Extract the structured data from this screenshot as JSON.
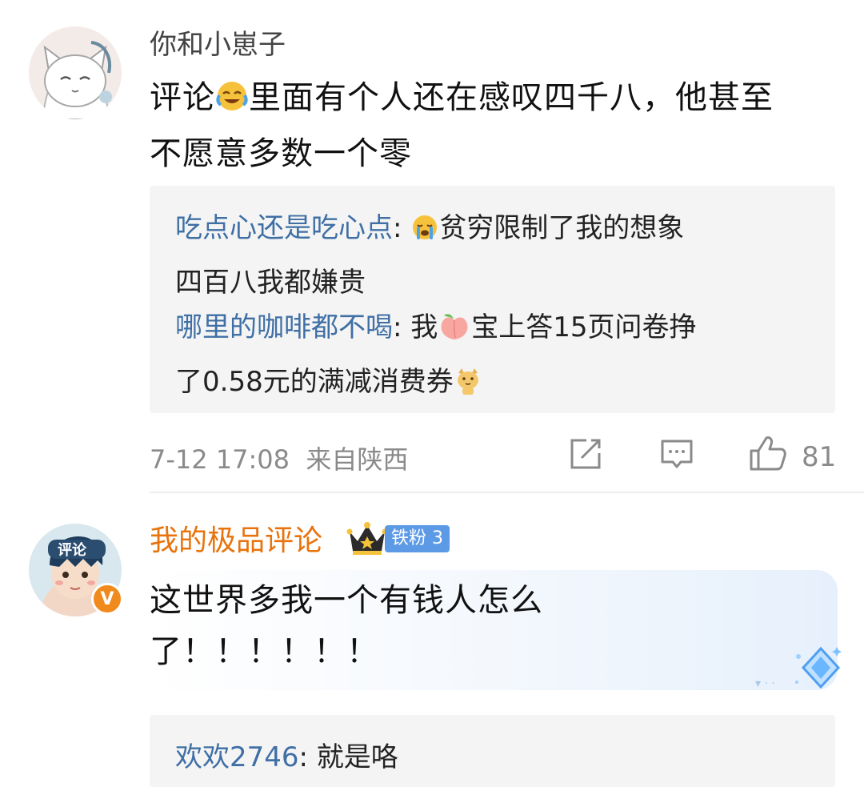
{
  "comment1": {
    "username": "你和小崽子",
    "text_a": "评论",
    "text_b": "里面有个人还在感叹四千八，他甚至",
    "text_c": "不愿意多数一个零",
    "replies": [
      {
        "name": "吃点心还是吃心点",
        "sep": ": ",
        "line1": "贫穷限制了我的想象",
        "line2": "四百八我都嫌贵"
      },
      {
        "name": "哪里的咖啡都不喝",
        "sep": ": ",
        "pre": "我",
        "post": "宝上答15页问卷挣",
        "line2": "了0.58元的满减消费券"
      }
    ],
    "time": "7-12 17:08",
    "location": "来自陕西",
    "like_count": "81"
  },
  "comment2": {
    "username": "我的极品评论",
    "badge": "铁粉",
    "badge_level": "3",
    "verified_mark": "V",
    "avatar_text": "评论",
    "text_a": "这世界多我一个有钱人怎么",
    "text_b": "了！！！！！！",
    "reply": {
      "name": "欢欢2746",
      "sep": ": ",
      "text": "就是咯"
    }
  },
  "colors": {
    "link_blue": "#3f6fa5",
    "orange_name": "#e8730c",
    "gray_meta": "#8a8a8a",
    "reply_bg": "#f4f4f4",
    "badge_blue": "#5d9ae6",
    "verified_orange": "#f08a1c"
  },
  "icons": [
    "share-icon",
    "comment-icon",
    "like-icon",
    "crown-icon",
    "diamond-icon"
  ]
}
